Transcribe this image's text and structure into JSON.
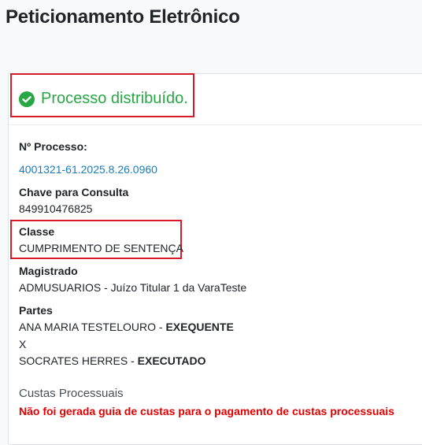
{
  "page": {
    "title": "Peticionamento Eletrônico"
  },
  "status": {
    "text": "Processo distribuído.",
    "icon": "check-circle-icon",
    "color": "#28a745"
  },
  "processo": {
    "label": "Nº Processo:",
    "numero": "4001321-61.2025.8.26.0960"
  },
  "chave": {
    "label": "Chave para Consulta",
    "value": "849910476825"
  },
  "classe": {
    "label": "Classe",
    "value": "CUMPRIMENTO DE SENTENÇA"
  },
  "magistrado": {
    "label": "Magistrado",
    "value": "ADMUSUARIOS - Juízo Titular 1 da VaraTeste"
  },
  "partes": {
    "label": "Partes",
    "items": [
      {
        "name": "ANA MARIA TESTELOURO - ",
        "role": "EXEQUENTE"
      },
      {
        "name": "SOCRATES HERRES - ",
        "role": "EXECUTADO"
      }
    ],
    "separator": "X"
  },
  "custas": {
    "label": "Custas Processuais",
    "message": "Não foi gerada guia de custas para o pagamento de custas processuais",
    "message_color": "#e30000"
  },
  "colors": {
    "highlight": "#d61a2b",
    "link": "#1a7cb8"
  }
}
